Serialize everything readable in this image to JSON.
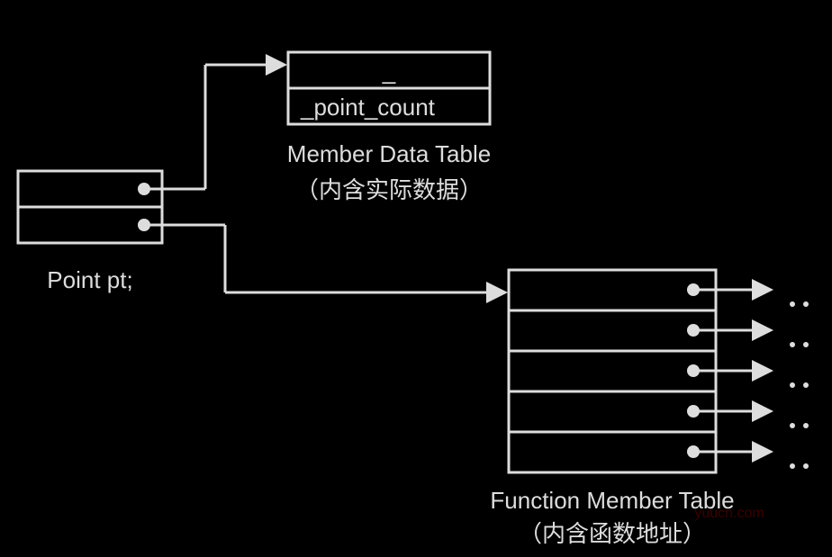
{
  "object_label": "Point pt;",
  "member_data_table": {
    "title": "Member Data Table",
    "subtitle": "（内含实际数据）",
    "rows": [
      "_",
      "_point_count"
    ]
  },
  "function_member_table": {
    "title": "Function Member Table",
    "subtitle": "（内含函数地址）",
    "row_count": 5
  },
  "watermark": "yuucn.com",
  "chart_data": {
    "type": "diagram",
    "description": "C++ 对象模型示意图：对象 pt 含两个指针槽，分别指向成员数据表与成员函数表",
    "nodes": [
      {
        "id": "pt",
        "label": "Point pt;",
        "slots": 2
      },
      {
        "id": "mdt",
        "label": "Member Data Table",
        "subtitle": "（内含实际数据）",
        "rows": [
          "_",
          "_point_count"
        ]
      },
      {
        "id": "fmt",
        "label": "Function Member Table",
        "subtitle": "（内含函数地址）",
        "rows": 5,
        "row_points_to": "..."
      }
    ],
    "edges": [
      {
        "from": "pt.slot0",
        "to": "mdt"
      },
      {
        "from": "pt.slot1",
        "to": "fmt"
      },
      {
        "from": "fmt.row0",
        "to": "external"
      },
      {
        "from": "fmt.row1",
        "to": "external"
      },
      {
        "from": "fmt.row2",
        "to": "external"
      },
      {
        "from": "fmt.row3",
        "to": "external"
      },
      {
        "from": "fmt.row4",
        "to": "external"
      }
    ]
  }
}
